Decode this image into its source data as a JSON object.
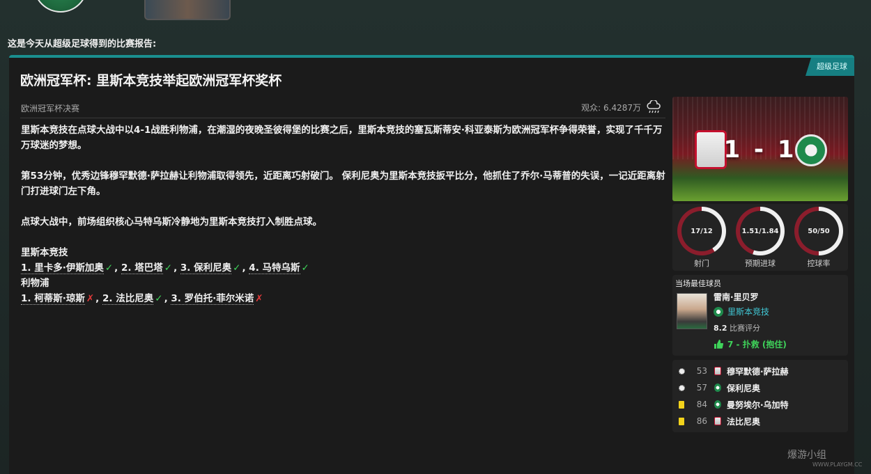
{
  "intro": "这是今天从超级足球得到的比赛报告:",
  "panel": {
    "tag": "超级足球",
    "headline": "欧洲冠军杯: 里斯本竞技举起欧洲冠军杯奖杯",
    "subhead": "欧洲冠军杯决赛",
    "attendance": "观众: 6.4287万",
    "weather_icon": "rain-cloud-icon"
  },
  "article": {
    "p1": "里斯本竞技在点球大战中以4-1战胜利物浦，在潮湿的夜晚圣彼得堡的比赛之后，里斯本竞技的塞瓦斯蒂安·科亚泰斯为欧洲冠军杯争得荣誉，实现了千千万万球迷的梦想。",
    "p2": "第53分钟，优秀边锋穆罕默德·萨拉赫让利物浦取得领先，近距离巧射破门。 保利尼奥为里斯本竞技扳平比分，他抓住了乔尔·马蒂普的失误，一记近距离射门打进球门左下角。",
    "p3": "点球大战中，前场组织核心马特乌斯冷静地为里斯本竞技打入制胜点球。",
    "team1": "里斯本竞技",
    "team1_kicks": [
      {
        "label": "1. 里卡多·伊斯加奥",
        "mark": "✓"
      },
      {
        "label": "2. 塔巴塔",
        "mark": "✓"
      },
      {
        "label": "3. 保利尼奥",
        "mark": "✓"
      },
      {
        "label": "4. 马特乌斯",
        "mark": "✓"
      }
    ],
    "team2": "利物浦",
    "team2_kicks": [
      {
        "label": "1. 柯蒂斯·琼斯",
        "mark": "✗"
      },
      {
        "label": "2. 法比尼奥",
        "mark": "✓"
      },
      {
        "label": "3. 罗伯托·菲尔米诺",
        "mark": "✗"
      }
    ]
  },
  "scorecard": {
    "score": "1 - 1",
    "home_crest": "liverpool-crest",
    "away_crest": "sporting-cp-crest"
  },
  "stats": [
    {
      "value": "17/12",
      "label": "射门",
      "home_share": 0.59
    },
    {
      "value": "1.51/1.84",
      "label": "预期进球",
      "home_share": 0.45
    },
    {
      "value": "50/50",
      "label": "控球率",
      "home_share": 0.5
    }
  ],
  "colors": {
    "home": "#8b1d2c",
    "away": "#f0f0f0",
    "accent": "#1a8f8f",
    "positive": "#3fd35a"
  },
  "best_player": {
    "title": "当场最佳球员",
    "name": "雷南·里贝罗",
    "club": "里斯本竞技",
    "rating": "8.2",
    "rating_label": "比赛评分",
    "saves": "7 - 扑救 (抱住)"
  },
  "events": [
    {
      "type": "goal",
      "minute": "53",
      "team": "lfc",
      "player": "穆罕默德·萨拉赫"
    },
    {
      "type": "goal",
      "minute": "57",
      "team": "scp",
      "player": "保利尼奥"
    },
    {
      "type": "yellow",
      "minute": "84",
      "team": "scp",
      "player": "曼努埃尔·乌加特"
    },
    {
      "type": "yellow",
      "minute": "86",
      "team": "lfc",
      "player": "法比尼奥"
    }
  ],
  "watermark": {
    "text": "爆游小组",
    "url": "WWW.PLAYGM.CC"
  }
}
